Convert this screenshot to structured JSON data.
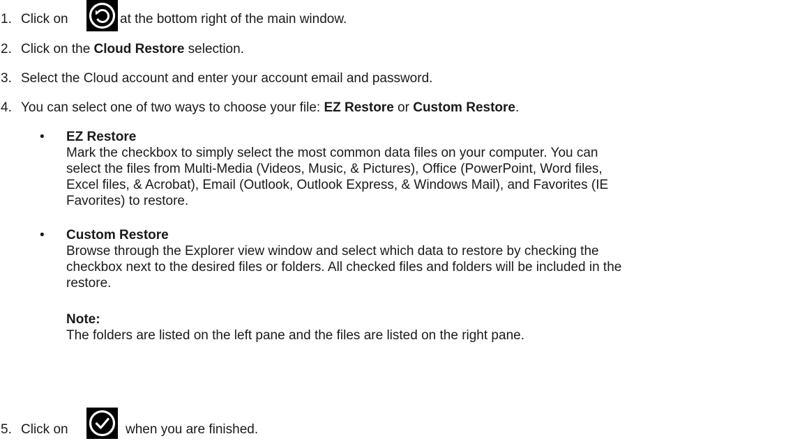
{
  "steps": [
    {
      "num": "1.",
      "before": "Click on",
      "after": "at the bottom right of the main window.",
      "icon": "restore-icon"
    },
    {
      "num": "2.",
      "pre": "Click on the ",
      "bold": "Cloud Restore",
      "post": " selection."
    },
    {
      "num": "3.",
      "text": "Select the Cloud account and enter your account email and password."
    },
    {
      "num": "4.",
      "pre": "You can select one of two ways to choose your file: ",
      "bold1": "EZ Restore",
      "mid": " or ",
      "bold2": "Custom Restore",
      "post": "."
    },
    {
      "num": "5.",
      "before": "Click on",
      "after": "when you are finished.",
      "icon": "check-icon"
    }
  ],
  "options": [
    {
      "bullet": "•",
      "title": "EZ Restore",
      "lines": [
        "Mark the checkbox to simply select the most common data files on your computer. You can",
        "select the files from Multi-Media (Videos, Music, & Pictures), Office (PowerPoint, Word files,",
        "Excel files, & Acrobat), Email (Outlook, Outlook Express, & Windows Mail), and Favorites (IE",
        "Favorites) to restore."
      ]
    },
    {
      "bullet": "•",
      "title": "Custom Restore",
      "lines": [
        "Browse through the Explorer view window and select which data to restore by checking the",
        "checkbox next to the desired files or folders. All checked files and folders will be included in the",
        "restore."
      ]
    }
  ],
  "note": {
    "title": "Note:",
    "text": "The folders are listed on the left pane and the files are listed on the right pane."
  }
}
